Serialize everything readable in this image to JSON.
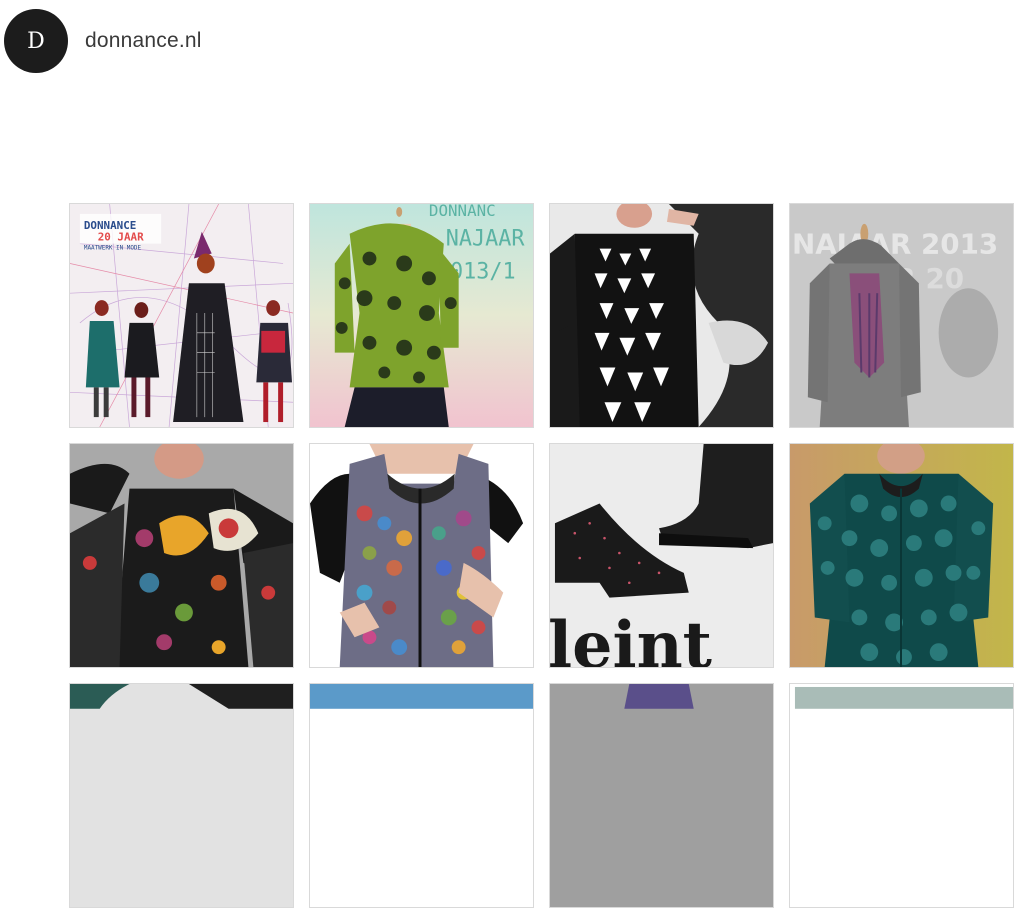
{
  "header": {
    "avatar_letter": "D",
    "site_name": "donnance.nl"
  },
  "gallery": {
    "items": [
      {
        "caption_lines": [
          "DONNANCE",
          "20 JAAR",
          "MAATWERK IN MODE"
        ]
      },
      {
        "caption_lines": [
          "DONNANC",
          "NAJAAR",
          "2013/1"
        ]
      },
      {
        "caption_lines": []
      },
      {
        "caption_lines": [
          "NAJAAR 2013",
          "AJAAR 20"
        ]
      },
      {
        "caption_lines": []
      },
      {
        "caption_lines": []
      },
      {
        "caption_lines": [
          "leint"
        ]
      },
      {
        "caption_lines": []
      },
      {
        "caption_lines": []
      },
      {
        "caption_lines": []
      },
      {
        "caption_lines": []
      },
      {
        "caption_lines": []
      }
    ]
  },
  "colors": {
    "avatar_bg": "#1c1c1c",
    "text": "#3a3a3a",
    "thumb_border": "#d9d9d9"
  }
}
